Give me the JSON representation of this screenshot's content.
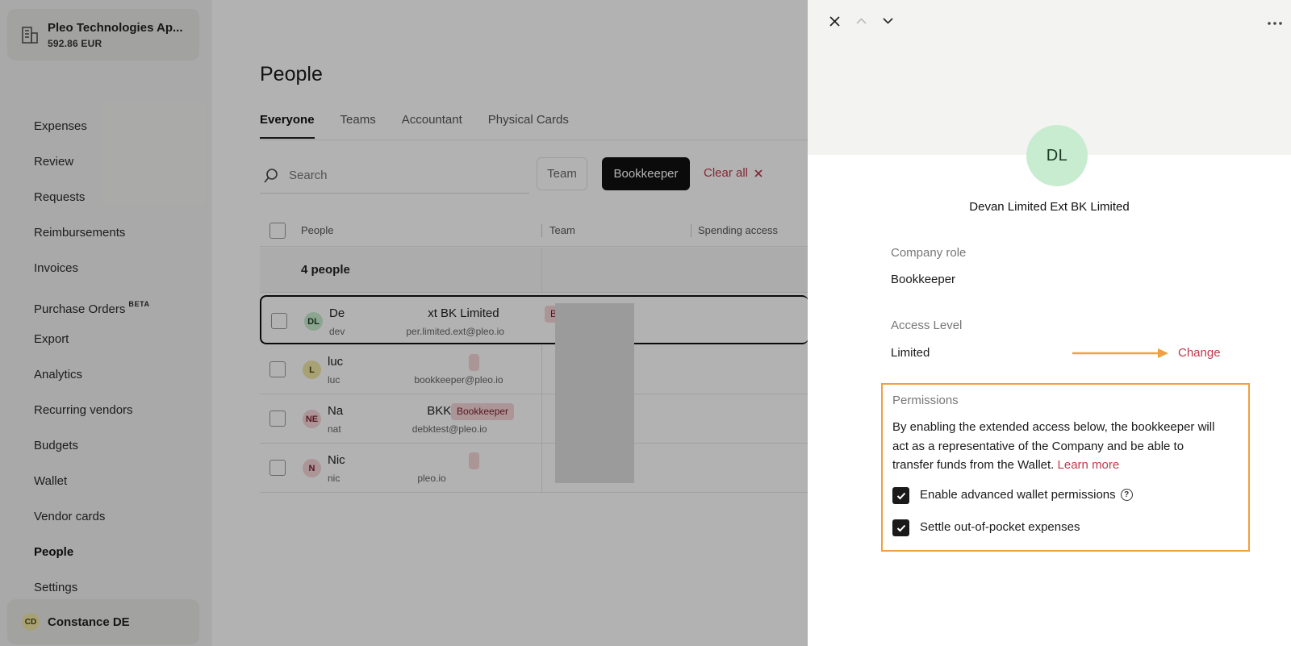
{
  "sidebar": {
    "company": {
      "name": "Pleo Technologies Ap...",
      "balance": "592.86 EUR"
    },
    "nav": [
      {
        "label": "Expenses"
      },
      {
        "label": "Review"
      },
      {
        "label": "Requests"
      },
      {
        "label": "Reimbursements"
      },
      {
        "label": "Invoices"
      },
      {
        "label": "Purchase Orders",
        "badge": "BETA"
      },
      {
        "label": "Export"
      },
      {
        "label": "Analytics"
      },
      {
        "label": "Recurring vendors"
      },
      {
        "label": "Budgets"
      },
      {
        "label": "Wallet"
      },
      {
        "label": "Vendor cards"
      },
      {
        "label": "People",
        "active": true
      },
      {
        "label": "Settings"
      }
    ],
    "user": {
      "initials": "CD",
      "name": "Constance DE"
    }
  },
  "main": {
    "title": "People",
    "tabs": [
      {
        "label": "Everyone",
        "active": true
      },
      {
        "label": "Teams"
      },
      {
        "label": "Accountant"
      },
      {
        "label": "Physical Cards"
      }
    ],
    "search_placeholder": "Search",
    "filters": {
      "team": "Team",
      "bookkeeper": "Bookkeeper",
      "clear_all": "Clear all"
    },
    "table": {
      "headers": {
        "people": "People",
        "team": "Team",
        "spending_access": "Spending access"
      },
      "group_label": "4 people",
      "rows": [
        {
          "initials": "DL",
          "name": "De",
          "name_tail": "xt BK Limited",
          "badge": "Bookkee",
          "email": "dev",
          "email_tail": "per.limited.ext@pleo.io"
        },
        {
          "initials": "L",
          "name": "luc",
          "email": "luc",
          "email_tail": "bookkeeper@pleo.io"
        },
        {
          "initials": "NE",
          "name": "Na",
          "name_tail": "BKK",
          "badge": "Bookkeeper",
          "email": "nat",
          "email_tail": "debktest@pleo.io"
        },
        {
          "initials": "N",
          "name": "Nic",
          "email": "nic",
          "email_tail": "pleo.io"
        }
      ]
    }
  },
  "drawer": {
    "initials": "DL",
    "name": "Devan Limited Ext BK Limited",
    "company_role_label": "Company role",
    "company_role_value": "Bookkeeper",
    "access_level_label": "Access Level",
    "access_level_value": "Limited",
    "change_label": "Change",
    "permissions": {
      "title": "Permissions",
      "description": "By enabling the extended access below, the bookkeeper will act as a representative of the Company and be able to transfer funds from the Wallet.",
      "learn_more": "Learn more",
      "options": [
        {
          "label": "Enable advanced wallet permissions",
          "checked": true,
          "help_icon": "question-circle-icon"
        },
        {
          "label": "Settle out-of-pocket expenses",
          "checked": true
        }
      ]
    }
  },
  "colors": {
    "accent_link": "#c0394e",
    "highlight": "#f0a040",
    "avatar_green": "#c8eccf",
    "badge_pink": "#f6d6d9"
  }
}
